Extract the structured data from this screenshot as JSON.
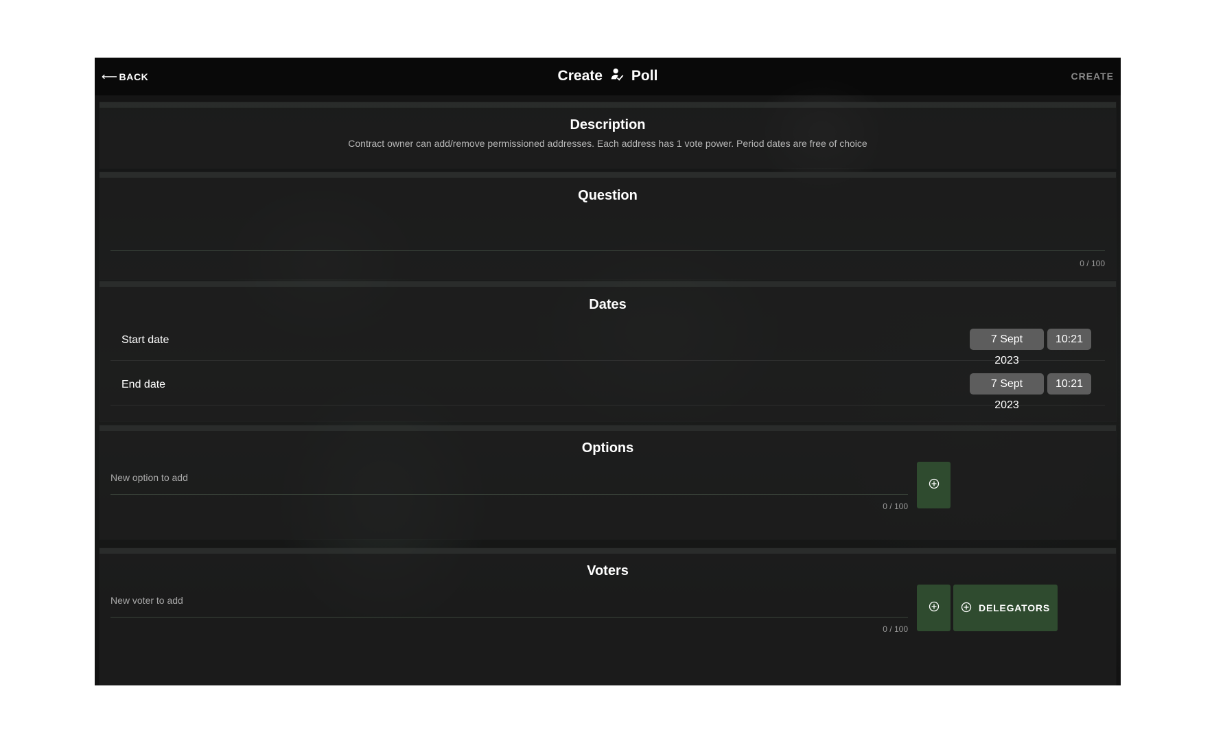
{
  "header": {
    "back_label": "BACK",
    "title_left": "Create",
    "title_right": "Poll",
    "create_label": "CREATE"
  },
  "description": {
    "heading": "Description",
    "text": "Contract owner can add/remove permissioned addresses. Each address has 1 vote power. Period dates are free of choice"
  },
  "question": {
    "heading": "Question",
    "value": "",
    "counter": "0 / 100"
  },
  "dates": {
    "heading": "Dates",
    "start": {
      "label": "Start date",
      "date": "7 Sept 2023",
      "time": "10:21"
    },
    "end": {
      "label": "End date",
      "date": "7 Sept 2023",
      "time": "10:21"
    }
  },
  "options": {
    "heading": "Options",
    "placeholder": "New option to add",
    "counter": "0 / 100"
  },
  "voters": {
    "heading": "Voters",
    "placeholder": "New voter to add",
    "counter": "0 / 100",
    "delegators_label": "DELEGATORS"
  },
  "colors": {
    "accent_button": "#2f4b2f",
    "chip_bg": "#5d5d5d"
  },
  "icons": [
    "back-arrow-icon",
    "person-check-icon",
    "add-circle-icon"
  ]
}
